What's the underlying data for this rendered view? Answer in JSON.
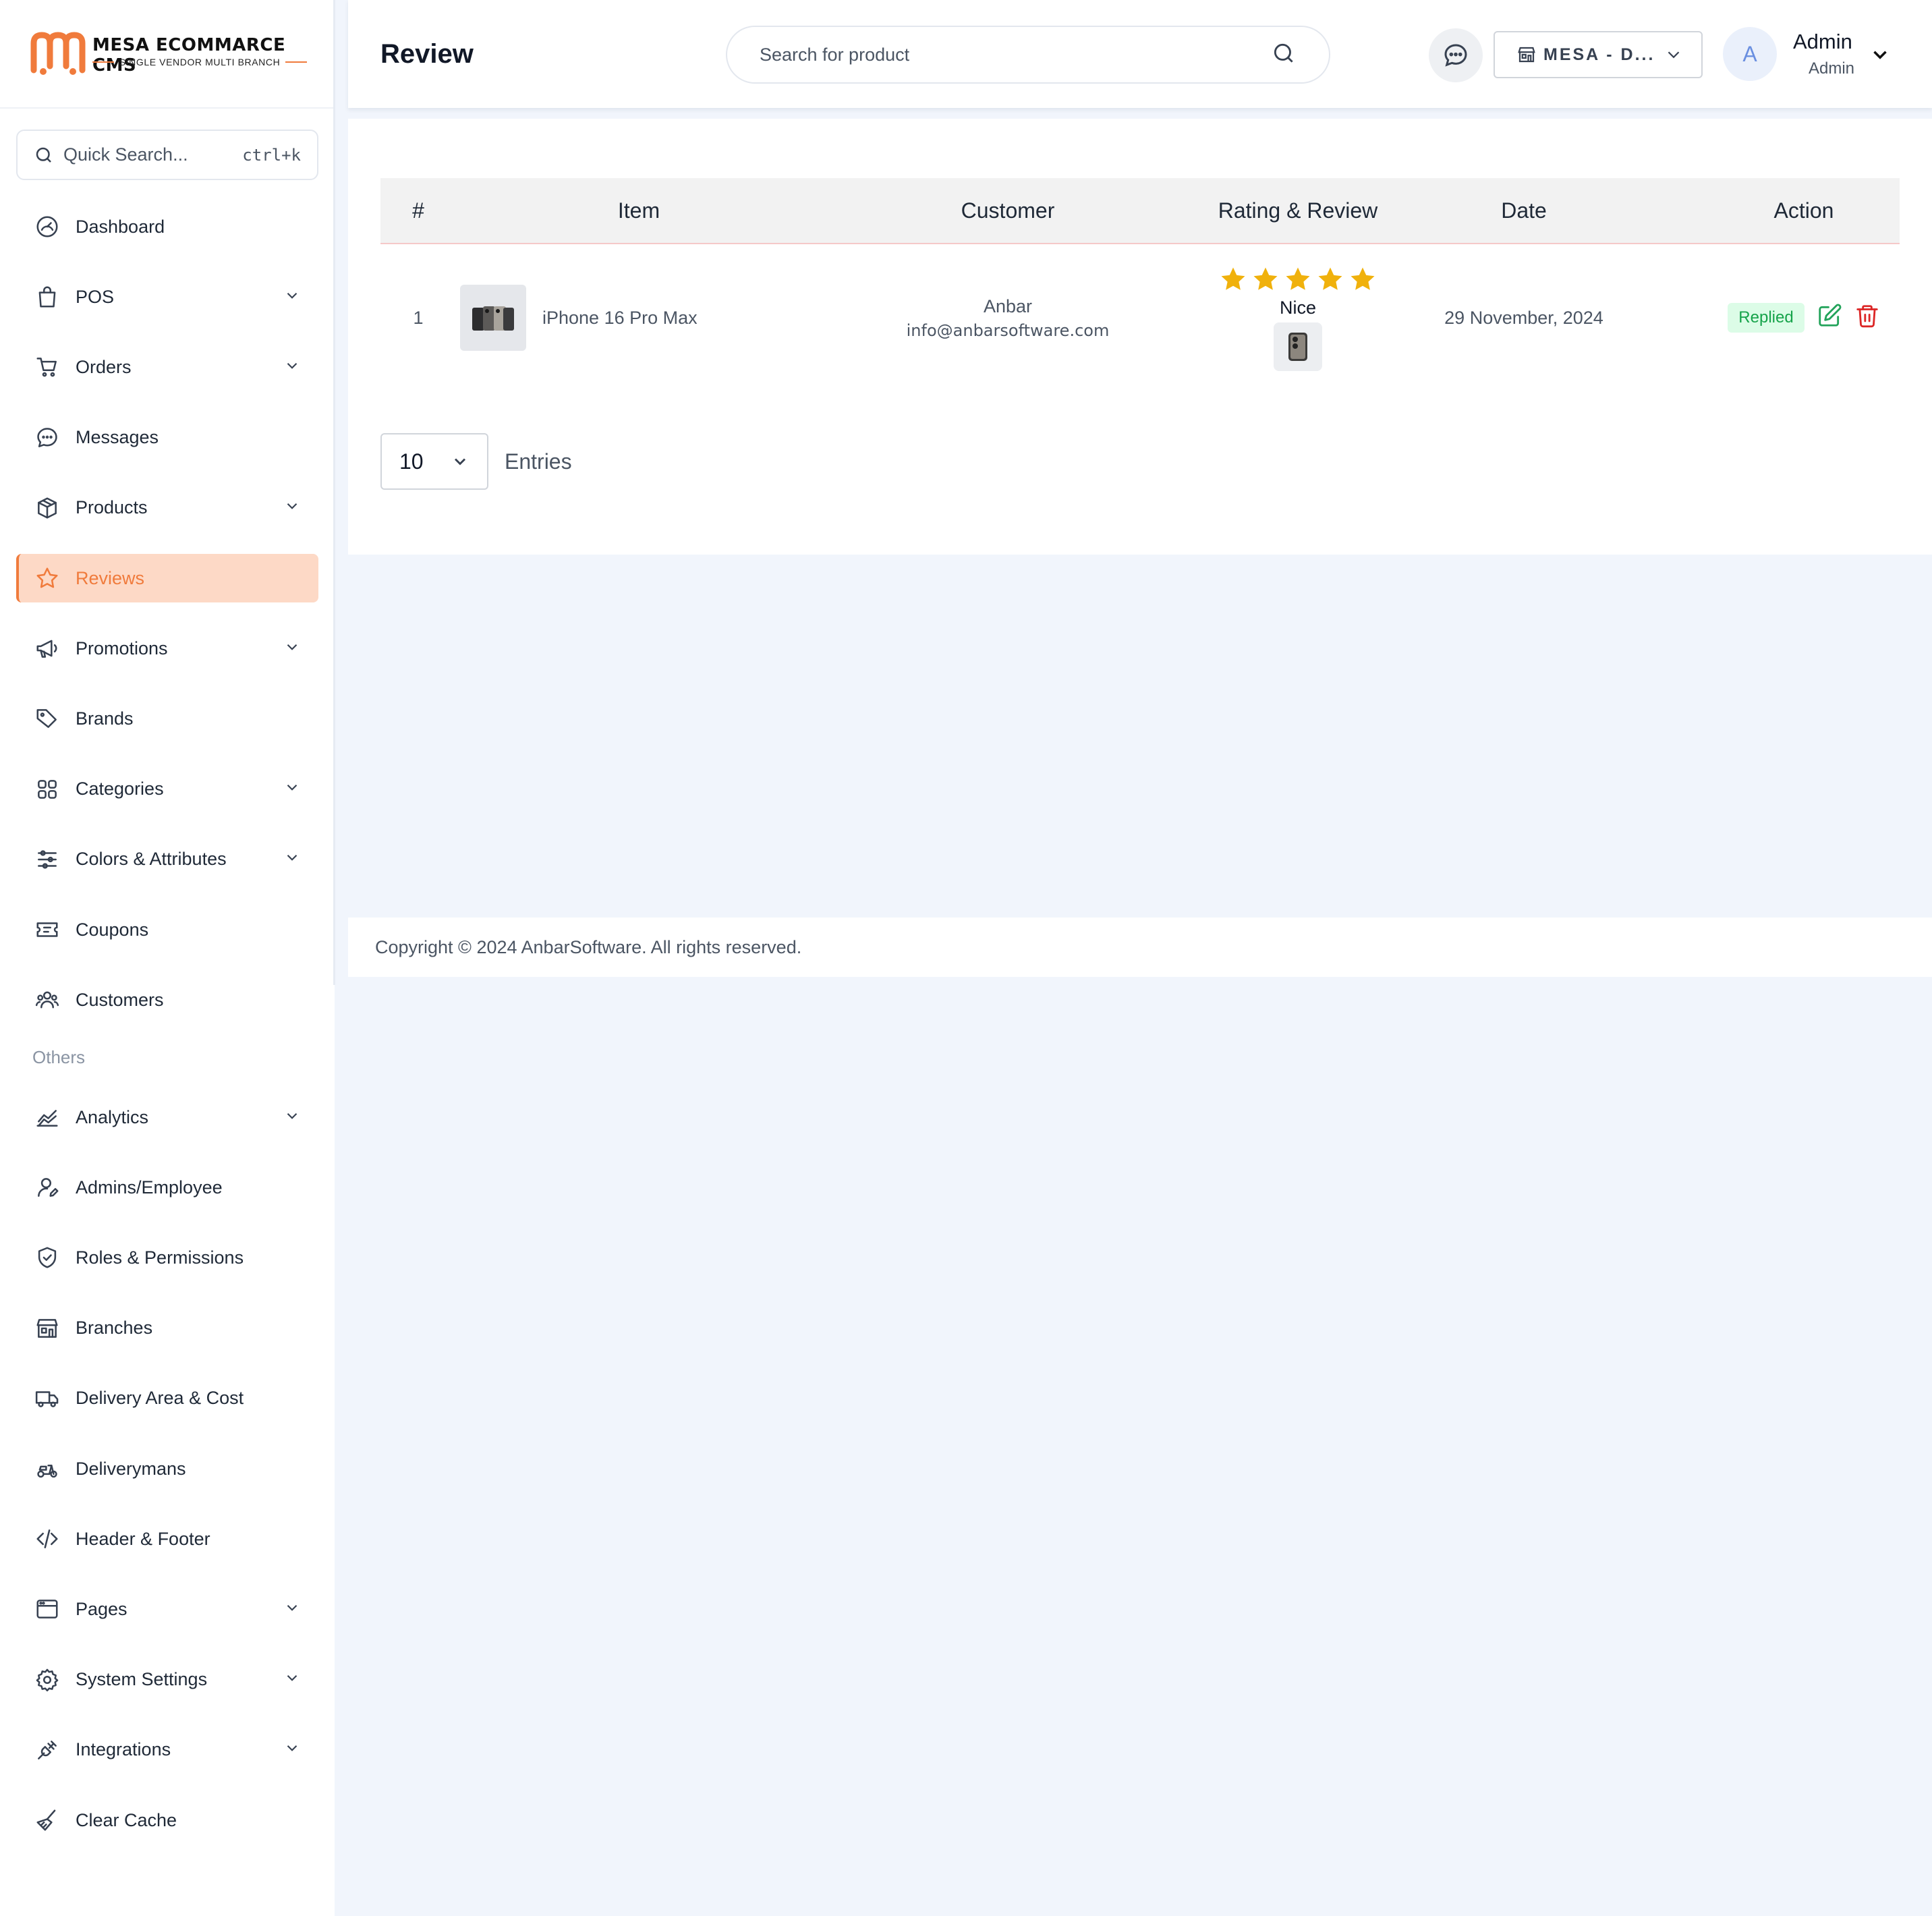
{
  "brand": {
    "title": "MESA ECOMMARCE CMS",
    "subtitle": "SINGLE VENDOR MULTI BRANCH",
    "accent": "#f07b3c"
  },
  "sidebar": {
    "quick_search": {
      "label": "Quick Search...",
      "shortcut": "ctrl+k"
    },
    "items": [
      {
        "label": "Dashboard",
        "icon": "gauge-icon",
        "chevron": false
      },
      {
        "label": "POS",
        "icon": "shopping-bag-icon",
        "chevron": true
      },
      {
        "label": "Orders",
        "icon": "cart-icon",
        "chevron": true
      },
      {
        "label": "Messages",
        "icon": "chat-icon",
        "chevron": false
      },
      {
        "label": "Products",
        "icon": "box-icon",
        "chevron": true
      },
      {
        "label": "Reviews",
        "icon": "star-icon",
        "chevron": false,
        "active": true
      },
      {
        "label": "Promotions",
        "icon": "megaphone-icon",
        "chevron": true
      },
      {
        "label": "Brands",
        "icon": "tag-icon",
        "chevron": false
      },
      {
        "label": "Categories",
        "icon": "grid-icon",
        "chevron": true
      },
      {
        "label": "Colors & Attributes",
        "icon": "sliders-icon",
        "chevron": true
      },
      {
        "label": "Coupons",
        "icon": "ticket-icon",
        "chevron": false
      },
      {
        "label": "Customers",
        "icon": "users-icon",
        "chevron": false
      }
    ],
    "section_others": "Others",
    "other_items": [
      {
        "label": "Analytics",
        "icon": "chart-icon",
        "chevron": true
      },
      {
        "label": "Admins/Employee",
        "icon": "user-edit-icon",
        "chevron": false
      },
      {
        "label": "Roles & Permissions",
        "icon": "shield-icon",
        "chevron": false
      },
      {
        "label": "Branches",
        "icon": "store-icon",
        "chevron": false
      },
      {
        "label": "Delivery Area & Cost",
        "icon": "truck-icon",
        "chevron": false
      },
      {
        "label": "Deliverymans",
        "icon": "scooter-icon",
        "chevron": false
      },
      {
        "label": "Header & Footer",
        "icon": "code-icon",
        "chevron": false
      },
      {
        "label": "Pages",
        "icon": "browser-icon",
        "chevron": true
      },
      {
        "label": "System Settings",
        "icon": "gear-icon",
        "chevron": true
      },
      {
        "label": "Integrations",
        "icon": "plug-icon",
        "chevron": true
      },
      {
        "label": "Clear Cache",
        "icon": "broom-icon",
        "chevron": false
      }
    ]
  },
  "header": {
    "title": "Review",
    "search_placeholder": "Search for product",
    "branch": "MESA - D...",
    "avatar_initial": "A",
    "user_name": "Admin",
    "user_role": "Admin"
  },
  "table": {
    "columns": [
      "#",
      "Item",
      "Customer",
      "Rating & Review",
      "Date",
      "Action"
    ],
    "rows": [
      {
        "index": "1",
        "item": "iPhone 16 Pro Max",
        "customer_name": "Anbar",
        "customer_email": "info@anbarsoftware.com",
        "rating": 5,
        "review": "Nice",
        "date": "29 November, 2024",
        "status": "Replied"
      }
    ]
  },
  "pagination": {
    "entries_value": "10",
    "entries_label": "Entries"
  },
  "footer": {
    "copyright": "Copyright © 2024 AnbarSoftware. All rights reserved."
  }
}
